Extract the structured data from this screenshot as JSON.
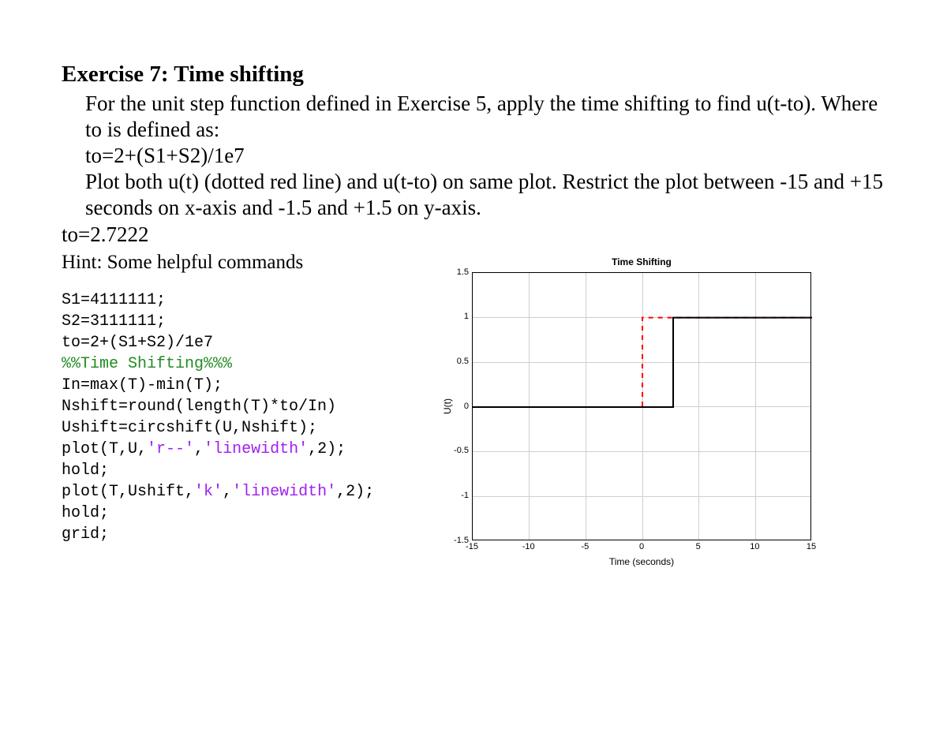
{
  "heading": "Exercise 7: Time shifting",
  "body": {
    "para1": "For the unit step function defined in Exercise 5, apply the time shifting to find u(t-to). Where to is defined as:",
    "eq": "to=2+(S1+S2)/1e7",
    "para2": "Plot both u(t) (dotted red line) and u(t-to) on same plot. Restrict the plot between -15 and +15 seconds on x-axis and -1.5 and +1.5 on y-axis."
  },
  "to_value": "to=2.7222",
  "hint": "Hint: Some helpful commands",
  "code": {
    "l1": "S1=4111111;",
    "l2": "S2=3111111;",
    "l3": "to=2+(S1+S2)/1e7",
    "l4": "%%Time Shifting%%%",
    "l5": "In=max(T)-min(T);",
    "l6": "Nshift=round(length(T)*to/In)",
    "l7": "Ushift=circshift(U,Nshift);",
    "l8a": "plot(T,U,",
    "l8s1": "'r--'",
    "l8b": ",",
    "l8s2": "'linewidth'",
    "l8c": ",2);",
    "l9": "hold;",
    "l10a": "plot(T,Ushift,",
    "l10s1": "'k'",
    "l10b": ",",
    "l10s2": "'linewidth'",
    "l10c": ",2);",
    "l11": "hold;",
    "l12": "grid;"
  },
  "chart_data": {
    "type": "line",
    "title": "Time Shifting",
    "xlabel": "Time (seconds)",
    "ylabel": "U(t)",
    "xlim": [
      -15,
      15
    ],
    "ylim": [
      -1.5,
      1.5
    ],
    "xticks": [
      -15,
      -10,
      -5,
      0,
      5,
      10,
      15
    ],
    "yticks": [
      -1.5,
      -1,
      -0.5,
      0,
      0.5,
      1,
      1.5
    ],
    "series": [
      {
        "name": "u(t)",
        "style": "red-dashed",
        "x": [
          -15,
          0,
          0,
          15
        ],
        "y": [
          0,
          0,
          1,
          1
        ]
      },
      {
        "name": "u(t-to)",
        "style": "black-solid",
        "x": [
          -15,
          2.7222,
          2.7222,
          15
        ],
        "y": [
          0,
          0,
          1,
          1
        ]
      }
    ]
  }
}
